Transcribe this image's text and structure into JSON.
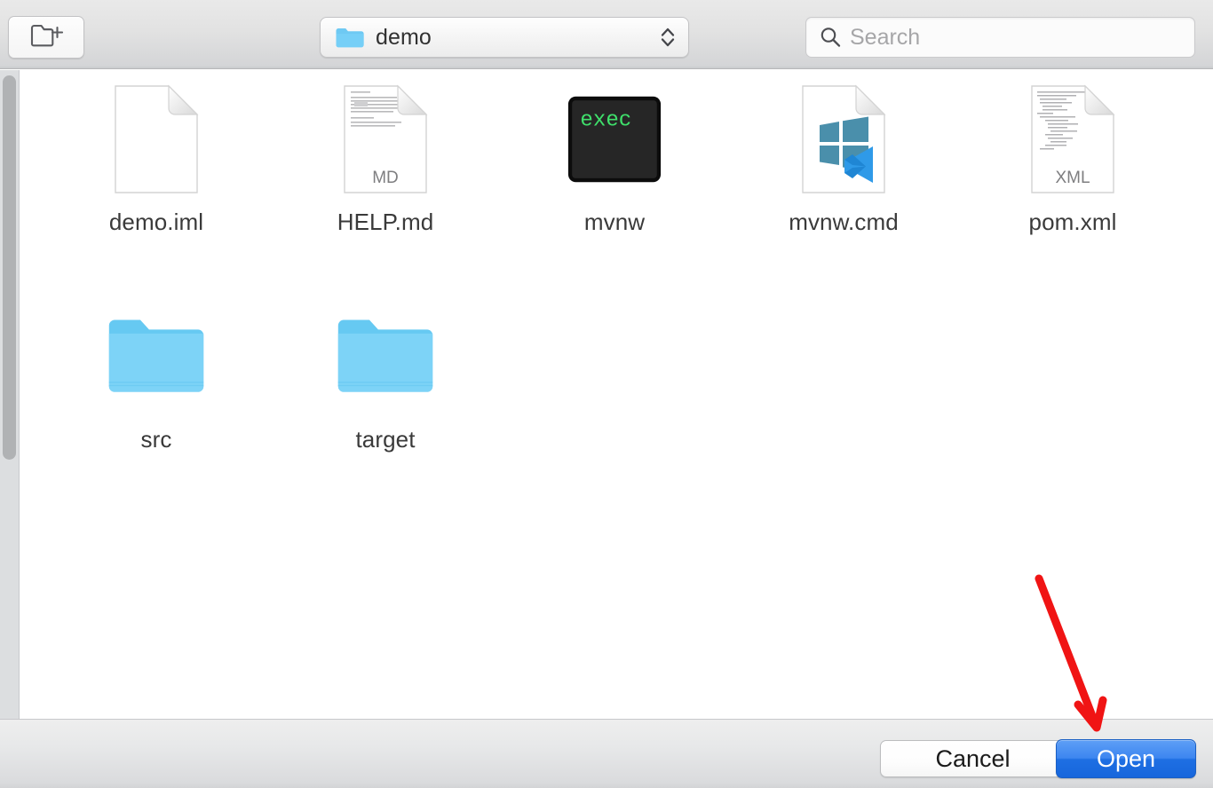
{
  "dialog": {
    "title": "Open file dialog",
    "toolbar": {
      "new_folder_button_name": "New Folder",
      "path_popup": {
        "label": "demo",
        "icon": "folder-icon",
        "stepper_icon": "up-down-chevron-icon"
      },
      "search": {
        "placeholder": "Search",
        "value": "",
        "icon": "search-icon"
      }
    },
    "files": [
      {
        "name": "demo.iml",
        "kind": "file",
        "icon": "blank-document-icon",
        "badge": ""
      },
      {
        "name": "HELP.md",
        "kind": "file",
        "icon": "text-document-icon",
        "badge": "MD"
      },
      {
        "name": "mvnw",
        "kind": "executable",
        "icon": "terminal-exec-icon",
        "badge": "exec"
      },
      {
        "name": "mvnw.cmd",
        "kind": "file",
        "icon": "windows-vscode-document-icon",
        "badge": ""
      },
      {
        "name": "pom.xml",
        "kind": "file",
        "icon": "code-document-icon",
        "badge": "XML"
      },
      {
        "name": "src",
        "kind": "folder",
        "icon": "folder-icon",
        "badge": ""
      },
      {
        "name": "target",
        "kind": "folder",
        "icon": "folder-icon",
        "badge": ""
      }
    ],
    "footer": {
      "cancel_label": "Cancel",
      "open_label": "Open"
    },
    "annotation": {
      "type": "arrow",
      "color": "#f01414",
      "points_to": "Open"
    },
    "colors": {
      "accent_blue": "#1e6fe3",
      "folder_blue": "#71cdf5",
      "annotation_red": "#f01414",
      "exec_green": "#3ddc67",
      "toolbar_gray": "#e5e5e5"
    },
    "scrollbar": {
      "orientation": "vertical",
      "position": "left"
    }
  }
}
